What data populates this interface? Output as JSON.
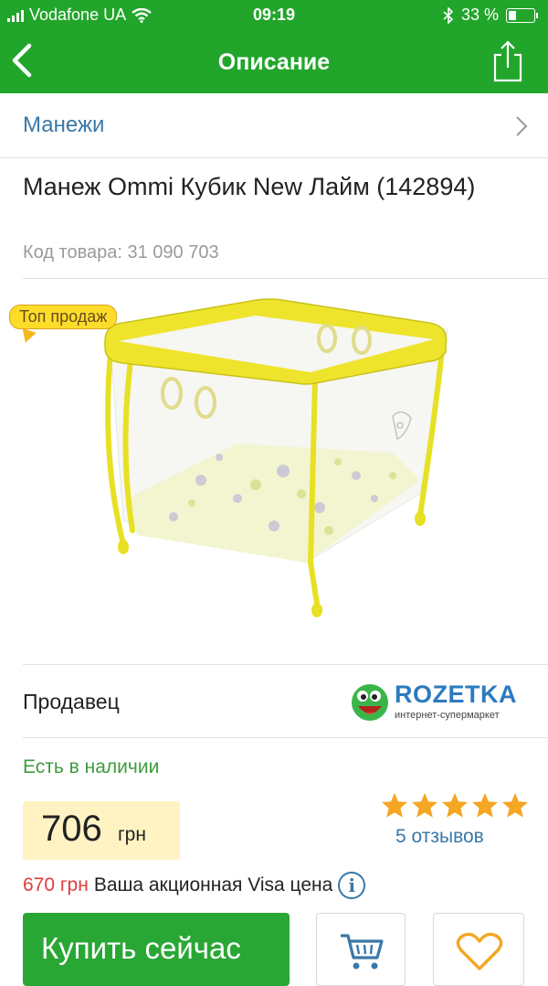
{
  "status_bar": {
    "carrier": "Vodafone UA",
    "time": "09:19",
    "battery": "33 %",
    "battery_level": 0.33
  },
  "navbar": {
    "title": "Описание",
    "back_icon": "chevron-left-icon",
    "share_icon": "share-icon"
  },
  "breadcrumb": {
    "label": "Манежи"
  },
  "product": {
    "title": "Манеж Ommi Кубик New Лайм (142894)",
    "code": "Код товара: 31 090 703",
    "badge": "Топ продаж"
  },
  "seller": {
    "label": "Продавец",
    "name": "ROZETKA",
    "tagline": "интернет-супермаркет"
  },
  "availability": "Есть в наличии",
  "price": {
    "value": "706",
    "currency": "грн"
  },
  "rating": {
    "stars": 5,
    "reviews": "5 отзывов"
  },
  "promo": {
    "price": "670 грн",
    "text": "Ваша акционная Visa цена",
    "info_icon": "i"
  },
  "actions": {
    "buy": "Купить сейчас",
    "cart_icon": "cart-icon",
    "wish_icon": "heart-icon"
  },
  "colors": {
    "brand_green": "#22a52b",
    "link_blue": "#3a78a8",
    "promo_red": "#e23b3b",
    "star_orange": "#f5a623",
    "price_bg": "#fff3c4"
  }
}
